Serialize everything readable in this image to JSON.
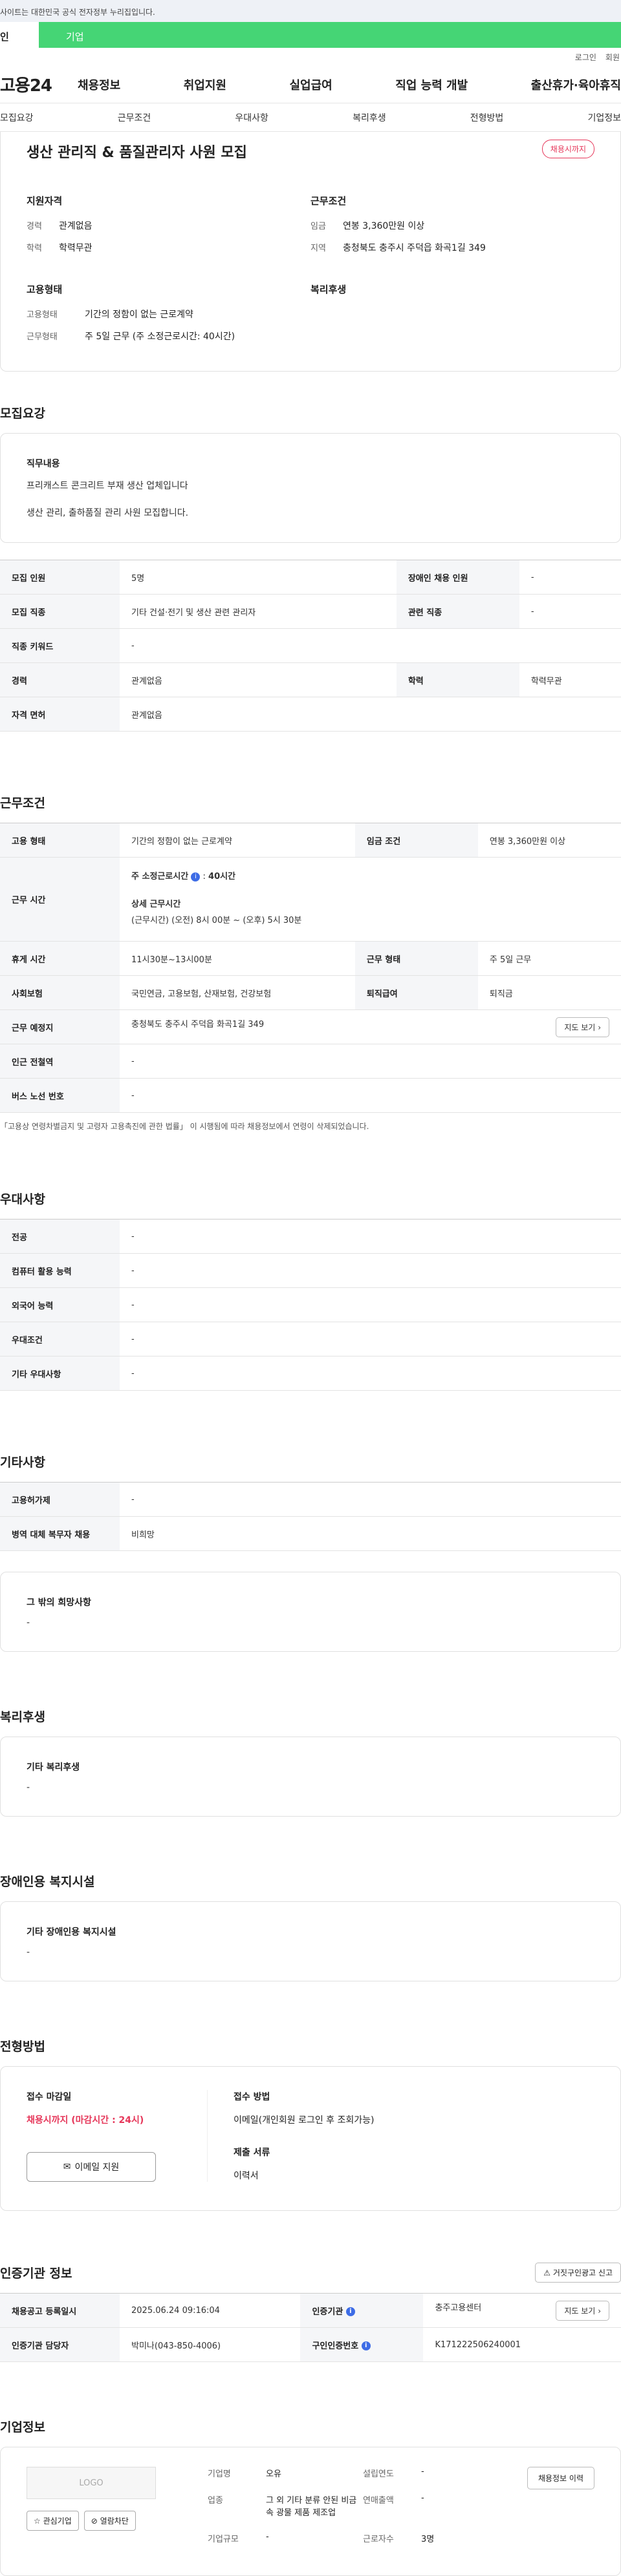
{
  "gov_banner": "사이트는 대한민국 공식 전자정부 누리집입니다.",
  "user_tabs": {
    "personal": "인",
    "company": "기업"
  },
  "util": {
    "login": "로그인",
    "join": "회원"
  },
  "logo": "고용24",
  "gnb": [
    "채용정보",
    "취업지원",
    "실업급여",
    "직업 능력 개발",
    "출산휴가·육아휴직"
  ],
  "anchors": [
    "모집요강",
    "근무조건",
    "우대사항",
    "복리후생",
    "전형방법",
    "기업정보"
  ],
  "job": {
    "title": "생산 관리직 & 품질관리자 사원 모집",
    "badge": "채용시까지",
    "qual_title": "지원자격",
    "career_k": "경력",
    "career_v": "관계없음",
    "edu_k": "학력",
    "edu_v": "학력무관",
    "cond_title": "근무조건",
    "pay_k": "임금",
    "pay_v": "연봉 3,360만원 이상",
    "region_k": "지역",
    "region_v": "충청북도 충주시 주덕읍 화곡1길 349",
    "type_title": "고용형태",
    "emp_k": "고용형태",
    "emp_v": "기간의 정함이 없는 근로계약",
    "work_k": "근무형태",
    "work_v": "주 5일 근무 (주 소정근로시간: 40시간)",
    "welfare_title": "복리후생"
  },
  "recruit": {
    "title": "모집요강",
    "duty_title": "직무내용",
    "duty_1": "프리캐스트 콘크리트 부재 생산 업체입니다",
    "duty_2": "생산 관리, 출하품질 관리 사원 모집합니다.",
    "t_count": "모집 인원",
    "v_count": "5명",
    "t_disabled": "장애인 채용 인원",
    "v_disabled": "-",
    "t_job": "모집 직종",
    "v_job": "기타 건설·전기 및 생산 관련 관리자",
    "t_related": "관련 직종",
    "v_related": "-",
    "t_keyword": "직종 키워드",
    "v_keyword": "-",
    "t_career": "경력",
    "v_career": "관계없음",
    "t_edu": "학력",
    "v_edu": "학력무관",
    "t_lang": "자격 면허",
    "v_lang": "관계없음"
  },
  "conditions": {
    "title": "근무조건",
    "t_emp": "고용 형태",
    "v_emp": "기간의 정함이 없는 근로계약",
    "t_wage": "임금 조건",
    "v_wage": "연봉 3,360만원 이상",
    "t_hours": "근무 시간",
    "hours_1": "주 소정근로시간",
    "hours_1b": "40시간",
    "hours_2": "상세 근무시간",
    "hours_3": "(근무시간) (오전) 8시 00분 ~ (오후) 5시 30분",
    "t_break": "휴게 시간",
    "v_break": "11시30분~13시00분",
    "t_form": "근무 형태",
    "v_form": "주 5일 근무",
    "t_ins": "사회보험",
    "v_ins": "국민연금, 고용보험, 산재보험, 건강보험",
    "t_ret": "퇴직급여",
    "v_ret": "퇴직금",
    "t_place": "근무 예정지",
    "v_place": "충청북도 충주시 주덕읍 화곡1길 349",
    "map_btn": "지도 보기",
    "t_subway": "인근 전철역",
    "v_subway": "-",
    "t_bus": "버스 노선 번호",
    "v_bus": "-",
    "note": "「고용상 연령차별금지 및 고령자 고용촉진에 관한 법률」 이 시행됨에 따라 채용정보에서 연령이 삭제되었습니다."
  },
  "pref": {
    "title": "우대사항",
    "t_major": "전공",
    "v_major": "-",
    "t_pc": "컴퓨터 활용 능력",
    "v_pc": "-",
    "t_lang": "외국어 능력",
    "v_lang": "-",
    "t_cond": "우대조건",
    "v_cond": "-",
    "t_etc": "기타 우대사항",
    "v_etc": "-"
  },
  "other": {
    "title": "기타사항",
    "t_equip": "고용허가제",
    "v_equip": "-",
    "t_mil": "병역 대체 복무자 채용",
    "v_mil": "비희망",
    "wish_title": "그 밖의 희망사항",
    "wish_v": "-"
  },
  "welfare": {
    "title": "복리후생",
    "sub": "기타 복리후생",
    "v": "-"
  },
  "disabled": {
    "title": "장애인용 복지시설",
    "sub": "기타 장애인용 복지시설",
    "v": "-"
  },
  "hiring": {
    "title": "전형방법",
    "deadline_t": "접수 마감일",
    "deadline_v": "채용시까지 (마감시간 : 24시)",
    "method_t": "접수 방법",
    "method_v": "이메일(개인회원 로그인 후 조회가능)",
    "docs_t": "제출 서류",
    "docs_v": "이력서",
    "email_btn": "이메일 지원"
  },
  "agency": {
    "title": "인증기관 정보",
    "report_btn": "거짓구인광고 신고",
    "t_reg": "채용공고 등록일시",
    "v_reg": "2025.06.24 09:16:04",
    "t_org": "인증기관",
    "v_org": "충주고용센터",
    "map_btn": "지도 보기",
    "t_mgr": "인증기관 담당자",
    "v_mgr": "박미나(043-850-4006)",
    "t_no": "구인인증번호",
    "v_no": "K171222506240001"
  },
  "company": {
    "title": "기업정보",
    "logo": "LOGO",
    "fav_btn": "관심기업",
    "block_btn": "열람차단",
    "history_btn": "채용정보 이력",
    "k_ceo": "기업명",
    "v_ceo": "오유",
    "k_year": "설립연도",
    "v_year": "-",
    "k_ind": "업종",
    "v_ind": "그 외 기타 분류 안된 비금속 광물 제품 제조업",
    "k_sales": "연매출액",
    "v_sales": "-",
    "k_emp": "근로자수",
    "v_emp": "3명",
    "k_size": "기업규모",
    "v_size": "-"
  }
}
